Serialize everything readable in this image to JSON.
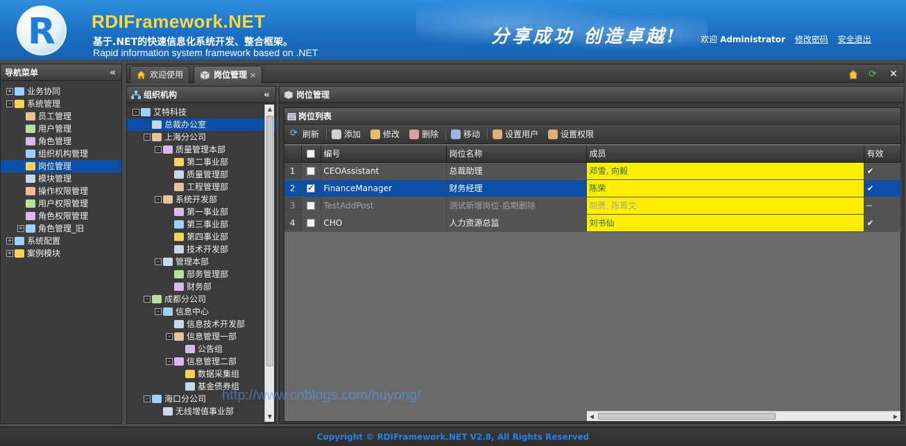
{
  "header": {
    "brand": "RDIFramework.NET",
    "subtitle_cn": "基于.NET的快速信息化系统开发、整合框架。",
    "subtitle_en": "Rapid information system framework based on .NET",
    "slogan": "分享成功  创造卓越!",
    "welcome": "欢迎",
    "username": "Administrator",
    "change_password": "修改密码",
    "logout": "安全退出"
  },
  "leftnav": {
    "title": "导航菜单",
    "items": [
      {
        "label": "业务协同",
        "level": 0,
        "expander": "+"
      },
      {
        "label": "系统管理",
        "level": 0,
        "expander": "-"
      },
      {
        "label": "员工管理",
        "level": 1
      },
      {
        "label": "用户管理",
        "level": 1
      },
      {
        "label": "角色管理",
        "level": 1
      },
      {
        "label": "组织机构管理",
        "level": 1
      },
      {
        "label": "岗位管理",
        "level": 1
      },
      {
        "label": "模块管理",
        "level": 1
      },
      {
        "label": "操作权限管理",
        "level": 1
      },
      {
        "label": "用户权限管理",
        "level": 1
      },
      {
        "label": "角色权限管理",
        "level": 1
      },
      {
        "label": "角色管理_旧",
        "level": 1,
        "expander": "+"
      },
      {
        "label": "系统配置",
        "level": 0,
        "expander": "+"
      },
      {
        "label": "案例模块",
        "level": 0,
        "expander": "+"
      }
    ]
  },
  "tabs": [
    {
      "label": "欢迎使用",
      "active": false
    },
    {
      "label": "岗位管理",
      "active": true,
      "close": "×"
    }
  ],
  "org": {
    "title": "组织机构",
    "nodes": [
      {
        "label": "艾特科技",
        "level": 0,
        "expander": "-"
      },
      {
        "label": "总裁办公室",
        "level": 1
      },
      {
        "label": "上海分公司",
        "level": 1,
        "expander": "-"
      },
      {
        "label": "质量管理本部",
        "level": 2,
        "expander": "-"
      },
      {
        "label": "第二事业部",
        "level": 3
      },
      {
        "label": "质量管理部",
        "level": 3
      },
      {
        "label": "工程管理部",
        "level": 3
      },
      {
        "label": "系统开发部",
        "level": 2,
        "expander": "-"
      },
      {
        "label": "第一事业部",
        "level": 3
      },
      {
        "label": "第三事业部",
        "level": 3
      },
      {
        "label": "第四事业部",
        "level": 3
      },
      {
        "label": "技术开发部",
        "level": 3
      },
      {
        "label": "管理本部",
        "level": 2,
        "expander": "-"
      },
      {
        "label": "部务管理部",
        "level": 3
      },
      {
        "label": "财务部",
        "level": 3
      },
      {
        "label": "成都分公司",
        "level": 1,
        "expander": "-"
      },
      {
        "label": "信息中心",
        "level": 2,
        "expander": "-"
      },
      {
        "label": "信息技术开发部",
        "level": 3
      },
      {
        "label": "信息管理一部",
        "level": 3,
        "expander": "-"
      },
      {
        "label": "公告组",
        "level": 4
      },
      {
        "label": "信息管理二部",
        "level": 3,
        "expander": "-"
      },
      {
        "label": "数据采集组",
        "level": 4
      },
      {
        "label": "基金债券组",
        "level": 4
      },
      {
        "label": "海口分公司",
        "level": 1,
        "expander": "-"
      },
      {
        "label": "无线增值事业部",
        "level": 2
      }
    ]
  },
  "main": {
    "title": "岗位管理",
    "grid_title": "岗位列表",
    "toolbar": {
      "refresh": "刷新",
      "add": "添加",
      "edit": "修改",
      "delete": "删除",
      "move": "移动",
      "set_users": "设置用户",
      "set_permissions": "设置权限"
    },
    "columns": {
      "code": "编号",
      "name": "岗位名称",
      "members": "成员",
      "enabled": "有效"
    },
    "rows": [
      {
        "n": "1",
        "code": "CEOAssistant",
        "name": "总裁助理",
        "members": "邓雪, 向毅",
        "enabled": "✔"
      },
      {
        "n": "2",
        "code": "FinanceManager",
        "name": "财务经理",
        "members": "陈荣",
        "enabled": "✔"
      },
      {
        "n": "3",
        "code": "TestAddPost",
        "name": "测试新增岗位-后期删除",
        "members": "胡勇, 陈菁文",
        "enabled": "━"
      },
      {
        "n": "4",
        "code": "CHO",
        "name": "人力资源总监",
        "members": "刘书仙",
        "enabled": "✔"
      }
    ]
  },
  "watermark": "http://www.cnblogs.com/huyong/",
  "footer": "Copyright © RDIFramework.NET V2.8, All Rights Reserved"
}
